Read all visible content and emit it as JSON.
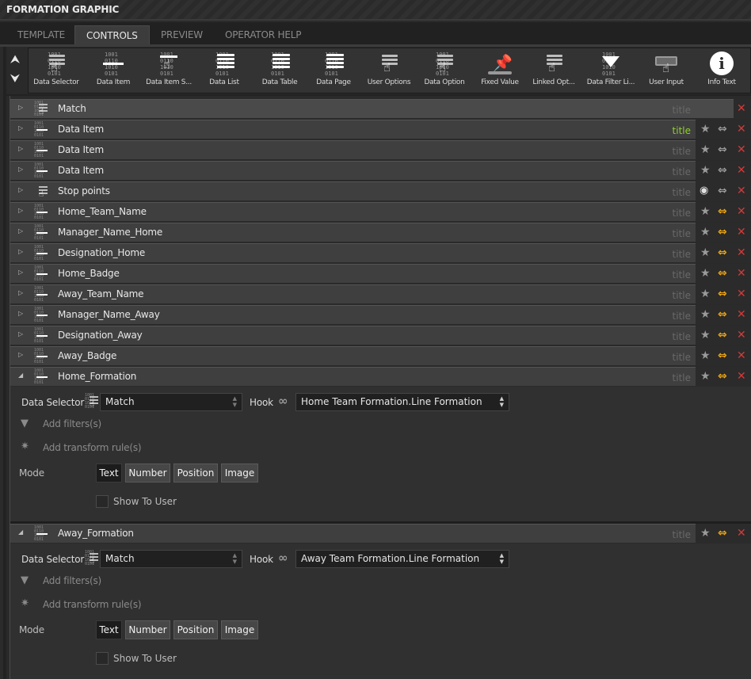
{
  "window": {
    "title": "FORMATION GRAPHIC"
  },
  "tabs": [
    {
      "label": "TEMPLATE",
      "active": false
    },
    {
      "label": "CONTROLS",
      "active": true
    },
    {
      "label": "PREVIEW",
      "active": false
    },
    {
      "label": "OPERATOR HELP",
      "active": false
    }
  ],
  "toolbar": {
    "scroll_up": "⌃",
    "scroll_down": "⌄",
    "tools": [
      {
        "label": "Data Selector",
        "icon": "data-selector-icon"
      },
      {
        "label": "Data Item",
        "icon": "data-item-icon"
      },
      {
        "label": "Data Item S...",
        "icon": "data-item-selector-icon"
      },
      {
        "label": "Data List",
        "icon": "data-list-icon"
      },
      {
        "label": "Data Table",
        "icon": "data-table-icon"
      },
      {
        "label": "Data Page",
        "icon": "data-page-icon"
      },
      {
        "label": "User Options",
        "icon": "user-options-icon"
      },
      {
        "label": "Data Option",
        "icon": "data-option-icon"
      },
      {
        "label": "Fixed Value",
        "icon": "pin-icon"
      },
      {
        "label": "Linked Opt...",
        "icon": "linked-options-icon"
      },
      {
        "label": "Data Filter Li...",
        "icon": "filter-icon"
      },
      {
        "label": "User Input",
        "icon": "keyboard-icon"
      },
      {
        "label": "Info Text",
        "icon": "info-icon"
      }
    ]
  },
  "controls": [
    {
      "name": "Match",
      "type": "data-selector",
      "title": "title",
      "title_highlight": false,
      "link_active": false,
      "expanded": false,
      "first": true
    },
    {
      "name": "Data Item",
      "type": "data-item",
      "title": "title",
      "title_highlight": true,
      "link_active": false,
      "expanded": false
    },
    {
      "name": "Data Item",
      "type": "data-item",
      "title": "title",
      "title_highlight": false,
      "link_active": false,
      "expanded": false
    },
    {
      "name": "Data Item",
      "type": "data-item",
      "title": "title",
      "title_highlight": false,
      "link_active": false,
      "expanded": false
    },
    {
      "name": "Stop points",
      "type": "user-options",
      "title": "title",
      "title_highlight": false,
      "link_active": false,
      "expanded": false,
      "visible_icon": true
    },
    {
      "name": "Home_Team_Name",
      "type": "data-item",
      "title": "title",
      "title_highlight": false,
      "link_active": true,
      "expanded": false
    },
    {
      "name": "Manager_Name_Home",
      "type": "data-item",
      "title": "title",
      "title_highlight": false,
      "link_active": true,
      "expanded": false
    },
    {
      "name": "Designation_Home",
      "type": "data-item",
      "title": "title",
      "title_highlight": false,
      "link_active": true,
      "expanded": false
    },
    {
      "name": "Home_Badge",
      "type": "data-item",
      "title": "title",
      "title_highlight": false,
      "link_active": true,
      "expanded": false
    },
    {
      "name": "Away_Team_Name",
      "type": "data-item",
      "title": "title",
      "title_highlight": false,
      "link_active": true,
      "expanded": false
    },
    {
      "name": "Manager_Name_Away",
      "type": "data-item",
      "title": "title",
      "title_highlight": false,
      "link_active": true,
      "expanded": false
    },
    {
      "name": "Designation_Away",
      "type": "data-item",
      "title": "title",
      "title_highlight": false,
      "link_active": true,
      "expanded": false
    },
    {
      "name": "Away_Badge",
      "type": "data-item",
      "title": "title",
      "title_highlight": false,
      "link_active": true,
      "expanded": false
    },
    {
      "name": "Home_Formation",
      "type": "data-item",
      "title": "title",
      "title_highlight": false,
      "link_active": true,
      "expanded": true
    },
    {
      "name": "Away_Formation",
      "type": "data-item",
      "title": "title",
      "title_highlight": false,
      "link_active": true,
      "expanded": true
    }
  ],
  "panels": [
    {
      "data_selector_label": "Data Selector",
      "data_selector_value": "Match",
      "hook_label": "Hook",
      "hook_value": "Home Team Formation.Line Formation",
      "add_filters": "Add filters(s)",
      "add_transform": "Add transform rule(s)",
      "mode_label": "Mode",
      "modes": [
        "Text",
        "Number",
        "Position",
        "Image"
      ],
      "active_mode": "Text",
      "show_to_user_label": "Show To User",
      "show_to_user": false
    },
    {
      "data_selector_label": "Data Selector",
      "data_selector_value": "Match",
      "hook_label": "Hook",
      "hook_value": "Away Team Formation.Line Formation",
      "add_filters": "Add filters(s)",
      "add_transform": "Add transform rule(s)",
      "mode_label": "Mode",
      "modes": [
        "Text",
        "Number",
        "Position",
        "Image"
      ],
      "active_mode": "Text",
      "show_to_user_label": "Show To User",
      "show_to_user": false
    }
  ],
  "colors": {
    "title_highlight": "#8fd02c",
    "link_active": "#e8a315",
    "delete": "#d23a3a"
  }
}
